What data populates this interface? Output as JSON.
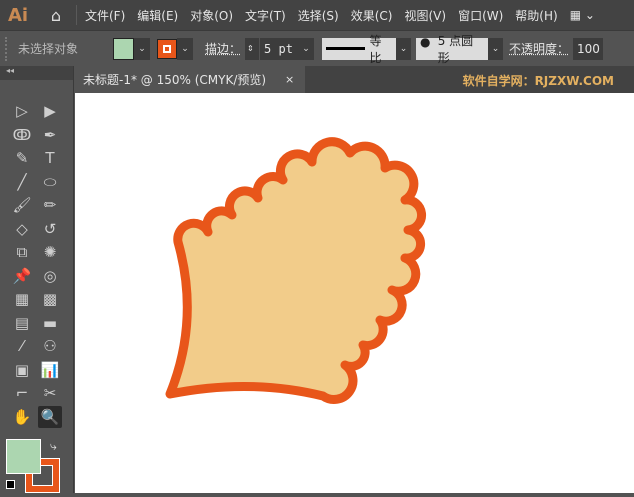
{
  "app": {
    "logo": "Ai",
    "home_icon": "home-icon"
  },
  "menu": [
    "文件(F)",
    "编辑(E)",
    "对象(O)",
    "文字(T)",
    "选择(S)",
    "效果(C)",
    "视图(V)",
    "窗口(W)",
    "帮助(H)"
  ],
  "control": {
    "selection": "未选择对象",
    "fill_color": "#acd6b0",
    "stroke_color": "#e8561a",
    "stroke_label": "描边：",
    "stroke_weight": "5 pt",
    "profile": "等比",
    "brush": "5 点圆形",
    "opacity_label": "不透明度：",
    "opacity": "100"
  },
  "document": {
    "tab_title": "未标题-1* @ 150% (CMYK/预览)",
    "close": "×",
    "watermark": "软件自学网：RJZXW.COM"
  },
  "shape": {
    "fill": "#f2cc8a",
    "stroke": "#e8561a"
  },
  "tools": [
    "direct-selection",
    "selection",
    "lasso",
    "pen",
    "curvature",
    "type",
    "line",
    "ellipse",
    "paintbrush",
    "pencil",
    "eraser",
    "rotate",
    "scale",
    "warp",
    "pin",
    "shape-builder",
    "perspective-grid",
    "mesh",
    "gradient",
    "measure",
    "eyedropper",
    "blend",
    "symbol-sprayer",
    "column-graph",
    "artboard",
    "slice",
    "hand",
    "zoom"
  ]
}
